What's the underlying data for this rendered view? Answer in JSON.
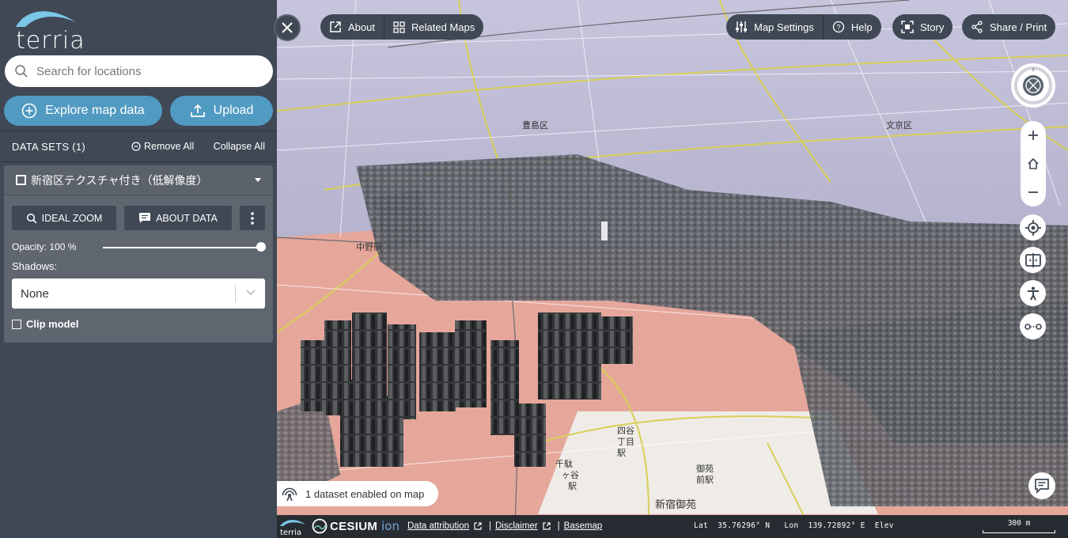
{
  "app": {
    "logo_text": "terria"
  },
  "search": {
    "placeholder": "Search for locations"
  },
  "actions": {
    "explore_label": "Explore map data",
    "upload_label": "Upload"
  },
  "datasets": {
    "header_title": "DATA SETS (1)",
    "remove_all_label": "Remove All",
    "collapse_all_label": "Collapse All",
    "items": [
      {
        "name": "新宿区テクスチャ付き（低解像度）",
        "ideal_zoom_label": "IDEAL ZOOM",
        "about_data_label": "ABOUT DATA",
        "opacity_label": "Opacity: 100 %",
        "opacity_value": 1.0,
        "shadows_label": "Shadows:",
        "shadows_selected": "None",
        "clip_label": "Clip model",
        "clip_checked": false,
        "enabled": true
      }
    ]
  },
  "toolbar": {
    "about_label": "About",
    "related_maps_label": "Related Maps",
    "map_settings_label": "Map Settings",
    "help_label": "Help",
    "story_label": "Story",
    "share_label": "Share / Print"
  },
  "map": {
    "labels": {
      "station_1": "千駄",
      "station_2": "ヶ谷",
      "station_3": "駅",
      "park": "新宿御苑",
      "park_gate": "御苑",
      "park_stn": "前駅",
      "area_1": "四谷",
      "area_2": "丁目",
      "area_3": "駅",
      "top_1": "豊島区",
      "top_2": "文京区",
      "side_1": "中野駅"
    },
    "enabled_status": "1 dataset enabled on map"
  },
  "footer": {
    "cesium_word": "CESIUM",
    "ion_word": "ion",
    "attribution_label": "Data attribution",
    "disclaimer_label": "Disclaimer",
    "basemap_label": "Basemap",
    "coords": "Lat  35.76296° N   Lon  139.72892° E  Elev",
    "scale_label": "300 m"
  },
  "colors": {
    "panel": "#3f4854",
    "accent": "#519ac2",
    "bottom_bar": "#272b32"
  },
  "icons": [
    "search-icon",
    "plus-circle-icon",
    "upload-icon",
    "minus-circle-icon",
    "checkbox-icon",
    "chevron-down-icon",
    "search-zoom-icon",
    "comment-icon",
    "kebab-icon",
    "close-icon",
    "external-link-icon",
    "grid-icon",
    "sliders-icon",
    "help-icon",
    "story-icon",
    "share-icon",
    "compass-icon",
    "zoom-in-icon",
    "home-icon",
    "zoom-out-icon",
    "locate-icon",
    "split-icon",
    "accessibility-icon",
    "measure-icon",
    "feedback-icon",
    "satellite-icon"
  ]
}
